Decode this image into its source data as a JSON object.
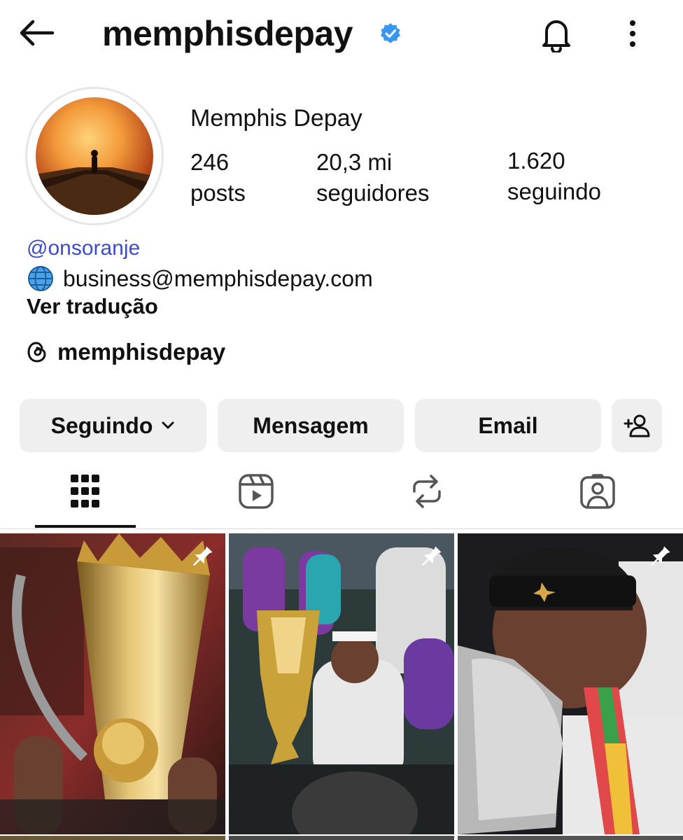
{
  "header": {
    "username": "memphisdepay"
  },
  "profile": {
    "display_name": "Memphis Depay",
    "stats": {
      "posts_count": "246",
      "posts_label": "posts",
      "followers_count": "20,3 mi",
      "followers_label": "seguidores",
      "following_count": "1.620",
      "following_label": "seguindo"
    },
    "bio": {
      "threads_mention": "@onsoranje",
      "email": "business@memphisdepay.com",
      "translate_label": "Ver tradução",
      "threads_handle": "memphisdepay"
    }
  },
  "actions": {
    "follow_label": "Seguindo",
    "message_label": "Mensagem",
    "email_label": "Email"
  },
  "tabs": [
    {
      "icon": "grid-icon",
      "active": true
    },
    {
      "icon": "reels-icon",
      "active": false
    },
    {
      "icon": "reposts-icon",
      "active": false
    },
    {
      "icon": "tagged-icon",
      "active": false
    }
  ],
  "posts": [
    {
      "icon": "pin-icon",
      "pinned": true
    },
    {
      "icon": "pin-icon",
      "pinned": true
    },
    {
      "icon": "pin-icon",
      "pinned": true
    }
  ],
  "colors": {
    "verified_blue": "#3897f0",
    "link_blue": "#3d4bd0",
    "button_bg": "#efefef"
  }
}
